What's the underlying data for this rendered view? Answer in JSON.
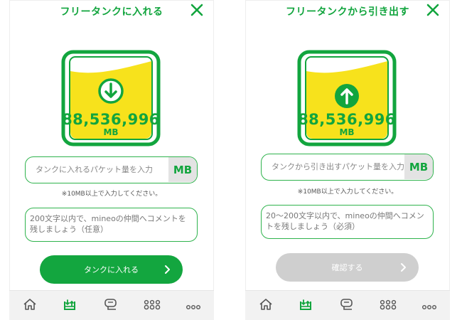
{
  "left_panel": {
    "title": "フリータンクに入れる",
    "tank": {
      "amount": "88,536,996",
      "unit": "MB",
      "direction": "down",
      "fill_level": 0.78
    },
    "packet_input": {
      "placeholder": "タンクに入れるパケット量を入力",
      "value": "",
      "unit": "MB"
    },
    "note": "※10MB以上で入力してください。",
    "comment": {
      "placeholder": "200文字以内で、mineoの仲間へコメントを残しましょう（任意）",
      "value": ""
    },
    "action_button": {
      "label": "タンクに入れる",
      "enabled": true
    }
  },
  "right_panel": {
    "title": "フリータンクから引き出す",
    "tank": {
      "amount": "88,536,996",
      "unit": "MB",
      "direction": "up",
      "fill_level": 0.78
    },
    "packet_input": {
      "placeholder": "タンクから引き出すパケット量を入力",
      "value": "",
      "unit": "MB"
    },
    "note": "※10MB以上で入力してください。",
    "comment": {
      "placeholder": "20〜200文字以内で、mineoの仲間へコメントを残しましょう（必須）",
      "value": ""
    },
    "action_button": {
      "label": "確認する",
      "enabled": false
    }
  },
  "tabbar": {
    "items": [
      {
        "icon": "home-icon",
        "active": false
      },
      {
        "icon": "tank-icon",
        "active": true
      },
      {
        "icon": "chat-icon",
        "active": false
      },
      {
        "icon": "community-icon",
        "active": false
      },
      {
        "icon": "more-icon",
        "active": false
      }
    ]
  },
  "colors": {
    "brand_green": "#12a53e",
    "tank_yellow": "#f7e21c",
    "disabled_gray": "#cfcfcf",
    "tab_inactive": "#555555"
  }
}
